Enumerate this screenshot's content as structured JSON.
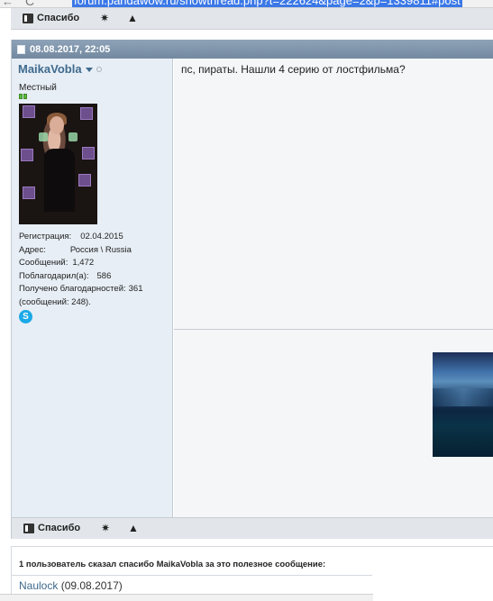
{
  "browser": {
    "url": "forum.pandawow.ru/showthread.php?t=222624&page=2&p=1339811#post"
  },
  "prev_post_actions": {
    "thanks_label": "Спасибо",
    "icon1": "star-burst-icon",
    "icon2": "warning-icon"
  },
  "post": {
    "date": "08.08.2017, 22:05",
    "user": {
      "name": "MaikaVobla",
      "title": "Местный",
      "reg_label": "Регистрация:",
      "reg_value": "02.04.2015",
      "addr_label": "Адрес:",
      "addr_value": "Россия \\ Russia",
      "posts_label": "Сообщений:",
      "posts_value": "1,472",
      "thanked_label": "Поблагодарил(а):",
      "thanked_value": "586",
      "received_label": "Получено благодарностей:",
      "received_value": "361",
      "received_sub": "(сообщений: 248).",
      "skype_icon": "skype-icon"
    },
    "message": "пс, пираты. Нашли 4 серию от лостфильма?",
    "footer": {
      "thanks_label": "Спасибо",
      "icon1": "star-burst-icon",
      "icon2": "warning-icon"
    }
  },
  "thanks_box": {
    "title": "1 пользователь сказал спасибо MaikaVobla за это полезное сообщение:",
    "users": [
      {
        "name": "Naulock",
        "date": "(09.08.2017)"
      }
    ]
  },
  "colors": {
    "header_bg": "#7d93a9",
    "username": "#3f6a8e",
    "sidebar_bg": "#e7eef5",
    "content_bg": "#f4f6f8"
  }
}
